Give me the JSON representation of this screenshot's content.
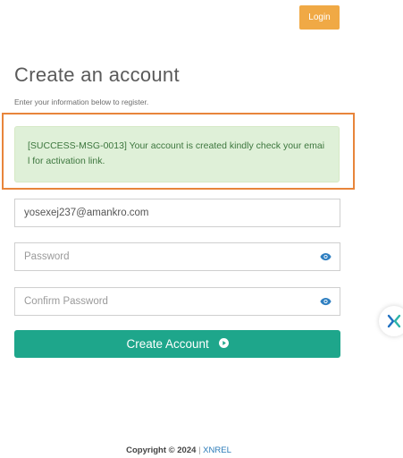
{
  "header": {
    "login_label": "Login"
  },
  "form": {
    "title": "Create an account",
    "subtitle": "Enter your information below to register.",
    "alert_message": "[SUCCESS-MSG-0013] Your account is created kindly check your email for activation link.",
    "email_value": "yosexej237@amankro.com",
    "password_placeholder": "Password",
    "confirm_password_placeholder": "Confirm Password",
    "submit_label": "Create Account"
  },
  "footer": {
    "copyright": "Copyright © 2024",
    "separator": "|",
    "brand": "XNREL"
  },
  "colors": {
    "login_button": "#f0a945",
    "submit_button": "#1ea68b",
    "alert_background": "#dff0d8",
    "alert_text": "#3c763d",
    "highlight_border": "#e8853b",
    "brand_link": "#2a7ab8"
  },
  "icons": {
    "password_toggle": "eye-icon",
    "submit_arrow": "play-circle-icon",
    "floating_widget": "x-logo-icon"
  }
}
